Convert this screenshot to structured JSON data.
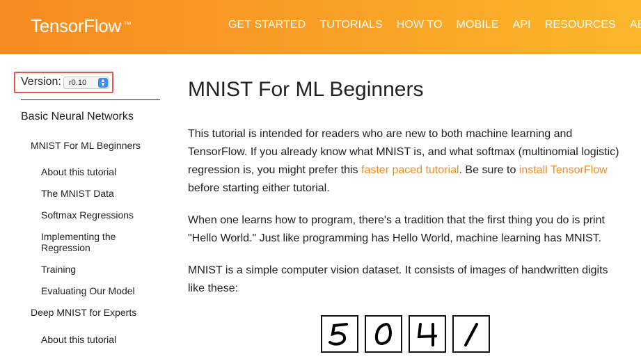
{
  "header": {
    "logo": "TensorFlow",
    "trademark": "™",
    "nav": [
      "GET STARTED",
      "TUTORIALS",
      "HOW TO",
      "MOBILE",
      "API",
      "RESOURCES",
      "ABOUT"
    ]
  },
  "sidebar": {
    "version_label": "Version:",
    "version_value": "r0.10",
    "items": [
      {
        "label": "Basic Neural Networks",
        "level": 0
      },
      {
        "label": "MNIST For ML Beginners",
        "level": 1
      },
      {
        "label": "About this tutorial",
        "level": 2
      },
      {
        "label": "The MNIST Data",
        "level": 2
      },
      {
        "label": "Softmax Regressions",
        "level": 2
      },
      {
        "label": "Implementing the Regression",
        "level": 2
      },
      {
        "label": "Training",
        "level": 2
      },
      {
        "label": "Evaluating Our Model",
        "level": 2
      },
      {
        "label": "Deep MNIST for Experts",
        "level": 1
      },
      {
        "label": "About this tutorial",
        "level": 2
      }
    ]
  },
  "main": {
    "title": "MNIST For ML Beginners",
    "p1": {
      "t1": "This tutorial is intended for readers who are new to both machine learning and TensorFlow. If you already know what MNIST is, and what softmax (multinomial logistic) regression is, you might prefer this ",
      "link1": "faster paced tutorial",
      "t2": ". Be sure to ",
      "link2": "install TensorFlow",
      "t3": " before starting either tutorial."
    },
    "p2": "When one learns how to program, there's a tradition that the first thing you do is print \"Hello World.\" Just like programming has Hello World, machine learning has MNIST.",
    "p3": "MNIST is a simple computer vision dataset. It consists of images of handwritten digits like these:",
    "digit_images": [
      "5",
      "0",
      "4",
      "1"
    ]
  },
  "colors": {
    "header_gradient_start": "#f68b1f",
    "header_gradient_end": "#fbb62c",
    "link": "#f58b1f",
    "version_highlight": "#e2574c",
    "select_arrow": "#3d8ef0"
  }
}
